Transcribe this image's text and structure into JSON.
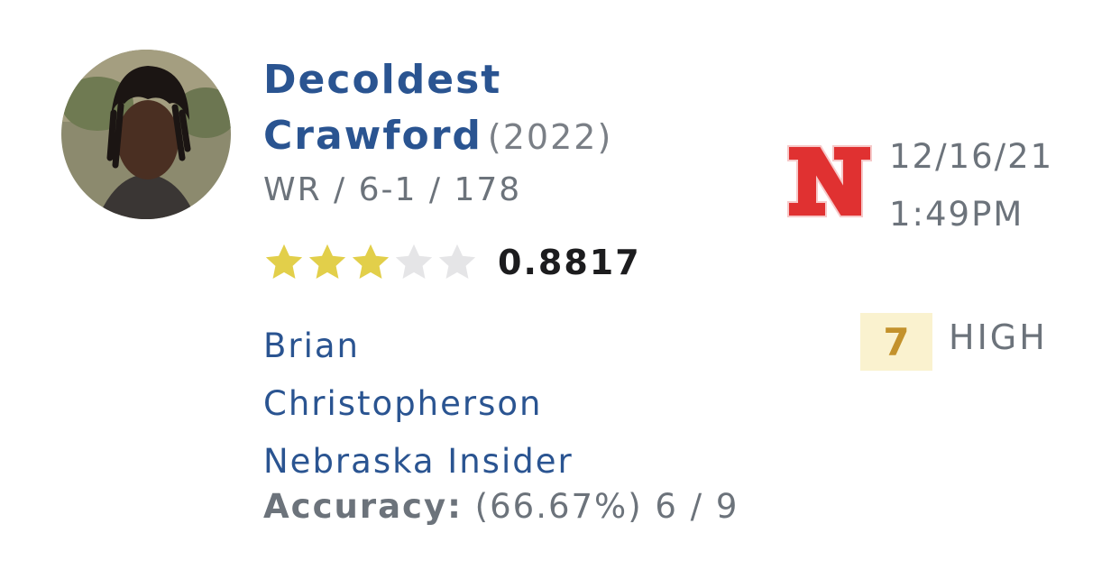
{
  "player": {
    "first_name": "Decoldest",
    "last_name": "Crawford",
    "class_year": "(2022)",
    "position_line": "WR / 6-1 / 178",
    "star_rating": 3,
    "star_max": 5,
    "rating": "0.8817"
  },
  "prediction": {
    "team_logo_letter": "N",
    "date": "12/16/21",
    "time": "1:49PM",
    "confidence_value": "7",
    "confidence_label": "HIGH"
  },
  "analyst": {
    "first_name": "Brian",
    "last_name": "Christopherson",
    "role": "Nebraska Insider",
    "accuracy_label": "Accuracy:",
    "accuracy_value": "(66.67%) 6 / 9"
  },
  "colors": {
    "name_blue": "#2a5491",
    "star_filled": "#e2cf4a",
    "star_empty": "#e5e5e7",
    "logo_red": "#e03131",
    "badge_bg": "#faf2cf",
    "badge_text": "#c3922c"
  }
}
